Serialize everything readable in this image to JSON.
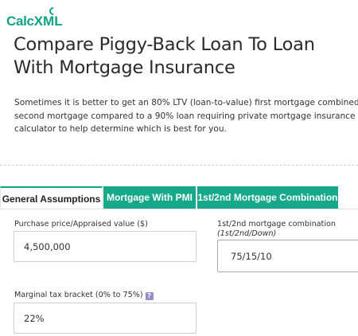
{
  "logo": {
    "text_calc": "Calc",
    "text_xml": "XML"
  },
  "page": {
    "title": "Compare Piggy-Back Loan To Loan With Mortgage Insurance",
    "intro_lines": [
      "Sometimes it is better to get an 80% LTV (loan-to-value) first mortgage combined with a",
      "second mortgage compared to a 90% loan requiring private mortgage insurance (PMI). U",
      "calculator to help determine which is best for you."
    ]
  },
  "tabs": [
    {
      "label": "General Assumptions",
      "active": true
    },
    {
      "label": "Mortgage With PMI",
      "active": false
    },
    {
      "label": "1st/2nd Mortgage Combination",
      "active": false
    }
  ],
  "form": {
    "purchase_price": {
      "label": "Purchase price/Appraised value ($)",
      "value": "4,500,000"
    },
    "combination": {
      "label": "1st/2nd mortgage combination",
      "sublabel": "(1st/2nd/Down)",
      "value": "75/15/10"
    },
    "tax_bracket": {
      "label": "Marginal tax bracket (0% to 75%)",
      "help_icon": "?",
      "value": "22%"
    }
  },
  "colors": {
    "accent": "#15a88b",
    "logo": "#0fa384",
    "help_icon": "#9b8cc9"
  }
}
